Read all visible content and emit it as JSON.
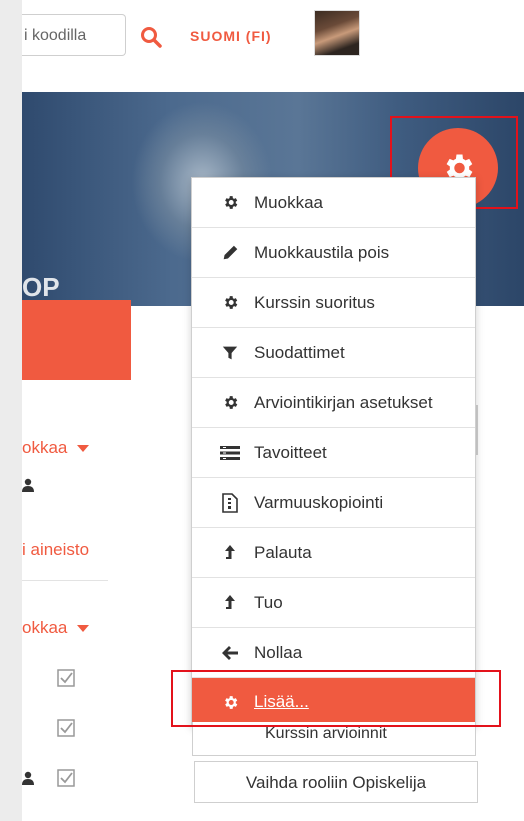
{
  "header": {
    "search_placeholder": "i koodilla",
    "language": "SUOMI (FI)"
  },
  "banner": {
    "text": "OP"
  },
  "left": {
    "edit_link_1": "okkaa",
    "material_link": "i aineisto",
    "edit_link_2": "okkaa"
  },
  "menu": {
    "items": [
      {
        "label": "Muokkaa",
        "icon": "gear-icon"
      },
      {
        "label": "Muokkaustila pois",
        "icon": "pencil-icon"
      },
      {
        "label": "Kurssin suoritus",
        "icon": "gear-icon"
      },
      {
        "label": "Suodattimet",
        "icon": "filter-icon"
      },
      {
        "label": "Arviointikirjan asetukset",
        "icon": "gear-icon"
      },
      {
        "label": "Tavoitteet",
        "icon": "list-icon"
      },
      {
        "label": "Varmuuskopiointi",
        "icon": "backup-file-icon"
      },
      {
        "label": "Palauta",
        "icon": "upload-arrow-icon"
      },
      {
        "label": "Tuo",
        "icon": "upload-arrow-icon"
      },
      {
        "label": "Nollaa",
        "icon": "arrow-left-icon"
      },
      {
        "label": "Lisää...",
        "icon": "gear-icon"
      }
    ],
    "partial_item": "Kurssin arvioinnit"
  },
  "role_switch": {
    "label": "Vaihda rooliin Opiskelija"
  },
  "colors": {
    "accent": "#f05a40",
    "highlight": "#e3121b"
  }
}
